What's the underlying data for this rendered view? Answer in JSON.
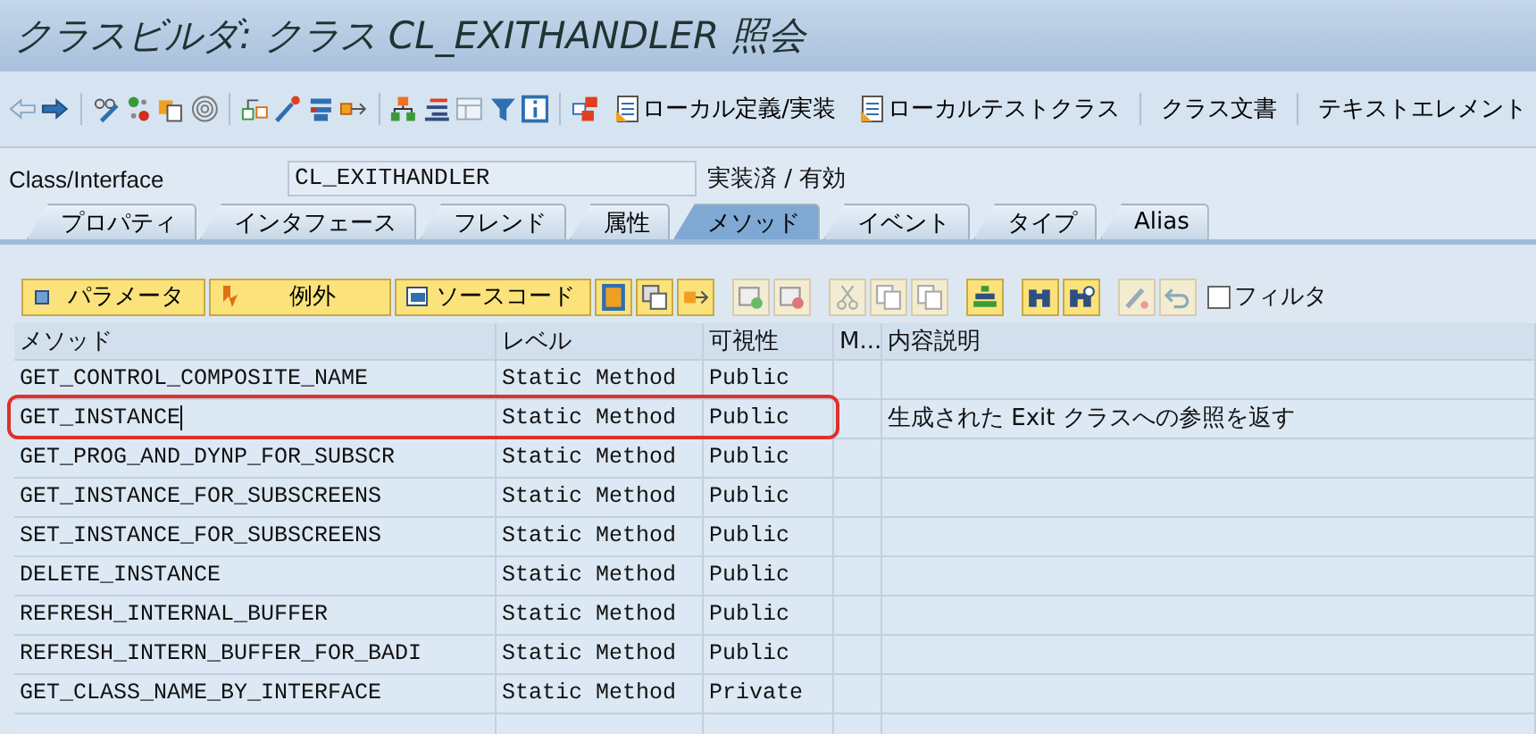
{
  "window": {
    "title": "クラスビルダ: クラス CL_EXITHANDLER 照会"
  },
  "toolbar": {
    "buttons": [
      "ローカル定義/実装",
      "ローカルテストクラス",
      "クラス文書",
      "テキストエレメント"
    ]
  },
  "class_field": {
    "label": "Class/Interface",
    "value": "CL_EXITHANDLER",
    "status": "実装済 / 有効"
  },
  "tabs": [
    {
      "label": "プロパティ",
      "selected": false
    },
    {
      "label": "インタフェース",
      "selected": false
    },
    {
      "label": "フレンド",
      "selected": false
    },
    {
      "label": "属性",
      "selected": false
    },
    {
      "label": "メソッド",
      "selected": true
    },
    {
      "label": "イベント",
      "selected": false
    },
    {
      "label": "タイプ",
      "selected": false
    },
    {
      "label": "Alias",
      "selected": false
    }
  ],
  "method_toolbar": {
    "buttons": [
      "パラメータ",
      "例外",
      "ソースコード"
    ],
    "filter": {
      "label": "フィルタ",
      "checked": false
    }
  },
  "table": {
    "columns": [
      "メソッド",
      "レベル",
      "可視性",
      "M...",
      "内容説明"
    ],
    "rows": [
      {
        "method": "GET_CONTROL_COMPOSITE_NAME",
        "level": "Static Method",
        "visibility": "Public",
        "description": "",
        "highlighted": false,
        "cursor": false
      },
      {
        "method": "GET_INSTANCE",
        "level": "Static Method",
        "visibility": "Public",
        "description": "生成された Exit クラスへの参照を返す",
        "highlighted": true,
        "cursor": true
      },
      {
        "method": "GET_PROG_AND_DYNP_FOR_SUBSCR",
        "level": "Static Method",
        "visibility": "Public",
        "description": "",
        "highlighted": false,
        "cursor": false
      },
      {
        "method": "GET_INSTANCE_FOR_SUBSCREENS",
        "level": "Static Method",
        "visibility": "Public",
        "description": "",
        "highlighted": false,
        "cursor": false
      },
      {
        "method": "SET_INSTANCE_FOR_SUBSCREENS",
        "level": "Static Method",
        "visibility": "Public",
        "description": "",
        "highlighted": false,
        "cursor": false
      },
      {
        "method": "DELETE_INSTANCE",
        "level": "Static Method",
        "visibility": "Public",
        "description": "",
        "highlighted": false,
        "cursor": false
      },
      {
        "method": "REFRESH_INTERNAL_BUFFER",
        "level": "Static Method",
        "visibility": "Public",
        "description": "",
        "highlighted": false,
        "cursor": false
      },
      {
        "method": "REFRESH_INTERN_BUFFER_FOR_BADI",
        "level": "Static Method",
        "visibility": "Public",
        "description": "",
        "highlighted": false,
        "cursor": false
      },
      {
        "method": "GET_CLASS_NAME_BY_INTERFACE",
        "level": "Static Method",
        "visibility": "Private",
        "description": "",
        "highlighted": false,
        "cursor": false
      }
    ]
  }
}
